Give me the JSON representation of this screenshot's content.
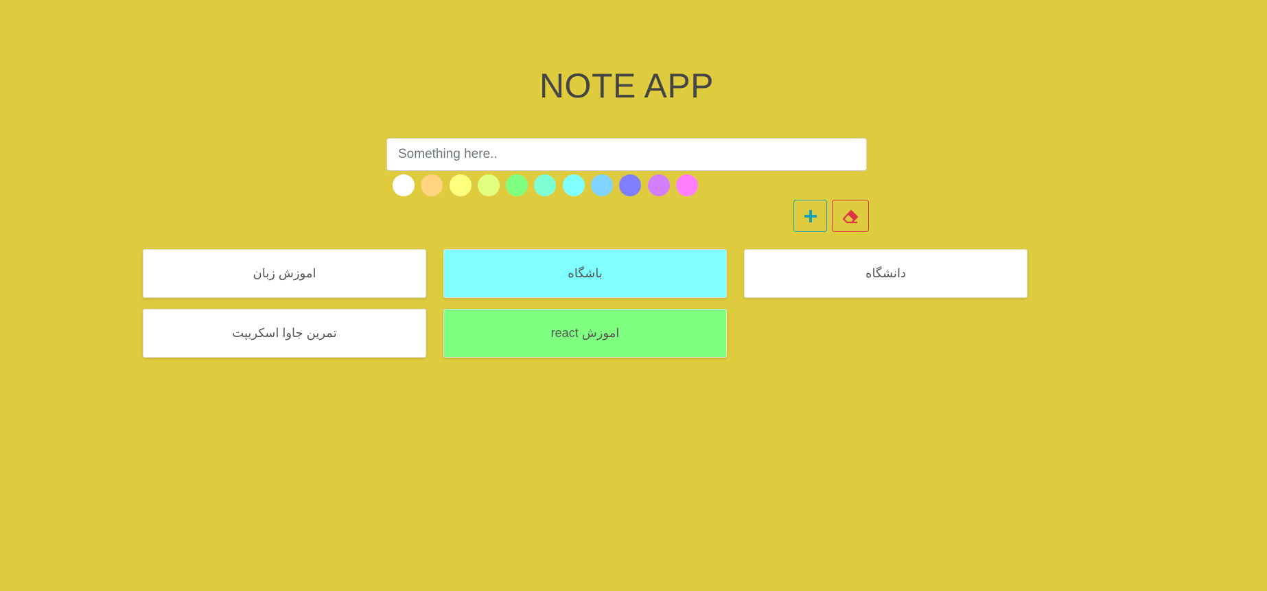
{
  "app": {
    "title": "NOTE APP"
  },
  "input": {
    "placeholder": "Something here..",
    "value": ""
  },
  "colors": [
    {
      "name": "white",
      "hex": "#ffffff"
    },
    {
      "name": "orange",
      "hex": "#ffd37f"
    },
    {
      "name": "yellow",
      "hex": "#ffff7f"
    },
    {
      "name": "lime",
      "hex": "#e2ff7f"
    },
    {
      "name": "green",
      "hex": "#7fff7f"
    },
    {
      "name": "mint",
      "hex": "#7fffd4"
    },
    {
      "name": "cyan",
      "hex": "#7fffff"
    },
    {
      "name": "sky",
      "hex": "#7fd4ff"
    },
    {
      "name": "blue",
      "hex": "#7f7fff"
    },
    {
      "name": "purple",
      "hex": "#d47fff"
    },
    {
      "name": "pink",
      "hex": "#ff7fff"
    }
  ],
  "actions": {
    "add_icon": "plus-icon",
    "clear_icon": "eraser-icon",
    "add_color": "#17a2b8",
    "clear_color": "#dc3545"
  },
  "notes": [
    {
      "text": "اموزش زبان",
      "color": "#ffffff"
    },
    {
      "text": "باشگاه",
      "color": "#7fffff"
    },
    {
      "text": "دانشگاه",
      "color": "#ffffff"
    },
    {
      "text": "تمرین جاوا اسکریپت",
      "color": "#ffffff"
    },
    {
      "text": "اموزش react",
      "color": "#7fff7f"
    }
  ]
}
